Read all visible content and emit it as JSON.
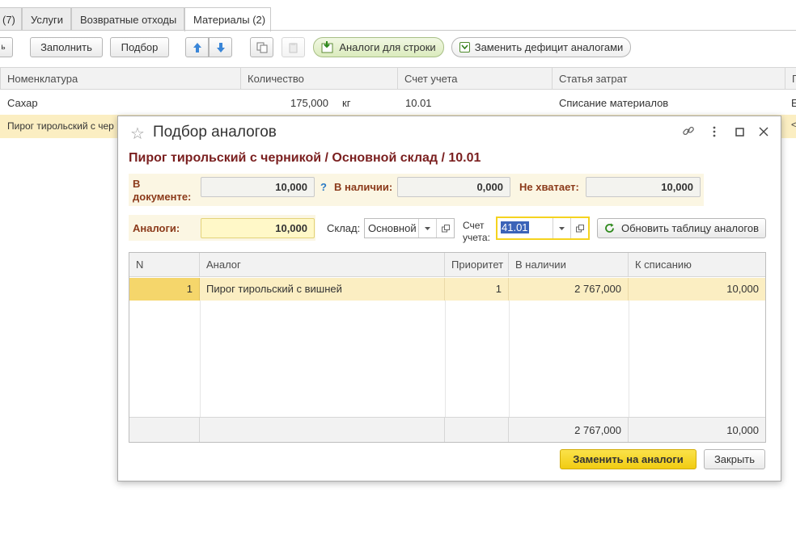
{
  "tabs": [
    {
      "label": "(7)"
    },
    {
      "label": "Услуги"
    },
    {
      "label": "Возвратные отходы"
    },
    {
      "label": "Материалы (2)"
    }
  ],
  "toolbar": {
    "fill": "Заполнить",
    "select": "Подбор",
    "analogs_for_row": "Аналоги для строки",
    "replace_deficit": "Заменить дефицит аналогами"
  },
  "grid": {
    "columns": [
      "Номенклатура",
      "Количество",
      "Счет учета",
      "Статья затрат",
      "П"
    ],
    "rows": [
      {
        "name": "Сахар",
        "qty": "175,000",
        "unit": "кг",
        "account": "10.01",
        "expense": "Списание материалов",
        "extra": "Е"
      },
      {
        "name": "Пирог тирольский с чер",
        "qty": "",
        "unit": "",
        "account": "",
        "expense": "",
        "extra": "<"
      }
    ]
  },
  "dialog": {
    "title": "Подбор аналогов",
    "subtitle": "Пирог тирольский с черникой / Основной склад / 10.01",
    "in_document_label": "В документе:",
    "in_document_value": "10,000",
    "help": "?",
    "available_label": "В наличии:",
    "available_value": "0,000",
    "shortage_label": "Не хватает:",
    "shortage_value": "10,000",
    "analogs_label": "Аналоги:",
    "analogs_value": "10,000",
    "warehouse_label": "Склад:",
    "warehouse_value": "Основной",
    "account_label": "Счет учета:",
    "account_value": "41.01",
    "refresh_button": "Обновить таблицу аналогов",
    "table": {
      "columns": [
        "N",
        "Аналог",
        "Приоритет",
        "В наличии",
        "К списанию"
      ],
      "rows": [
        {
          "n": "1",
          "analog": "Пирог тирольский с вишней",
          "priority": "1",
          "available": "2 767,000",
          "writeoff": "10,000"
        }
      ],
      "footer": {
        "available": "2 767,000",
        "writeoff": "10,000"
      }
    },
    "replace_button": "Заменить на аналоги",
    "close_button": "Закрыть"
  },
  "colors": {
    "accent_yellow": "#f5d31f",
    "selected_row": "#fbeec2",
    "title_brown": "#7a1f1f",
    "label_brown": "#8b3a1a"
  }
}
